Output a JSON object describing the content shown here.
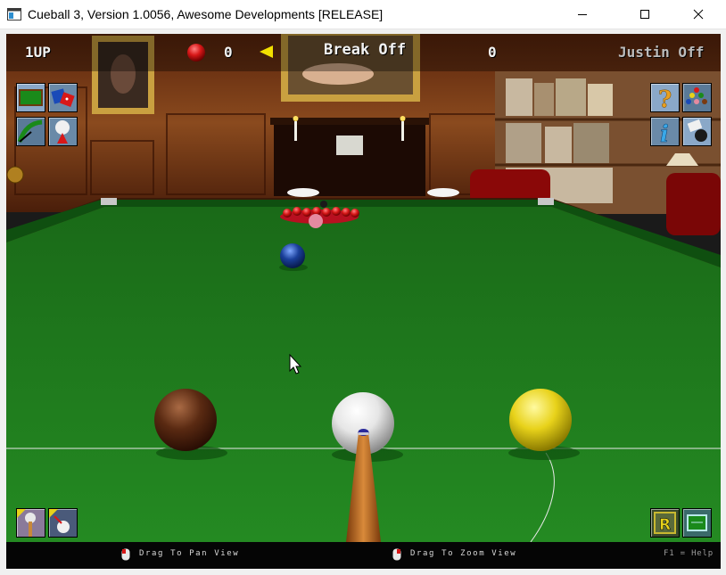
{
  "window": {
    "title": "Cueball 3, Version 1.0056, Awesome Developments [RELEASE]",
    "buttons": [
      "minimize",
      "maximize",
      "close"
    ]
  },
  "hud": {
    "player1_label": "1UP",
    "player1_score": "0",
    "status_message": "Break Off",
    "player2_score": "0",
    "player2_label": "Justin Off",
    "ball_on_color": "#d81818",
    "turn_indicator_color": "#f2e000"
  },
  "toolbar_left_top": [
    {
      "name": "table-view-icon"
    },
    {
      "name": "dice-icon"
    },
    {
      "name": "cue-aim-icon"
    },
    {
      "name": "cue-ball-spin-icon"
    }
  ],
  "toolbar_right_top": [
    {
      "name": "help-icon"
    },
    {
      "name": "ball-rack-icon"
    },
    {
      "name": "info-icon"
    },
    {
      "name": "camera-icon"
    }
  ],
  "toolbar_bottom_left": [
    {
      "name": "cue-height-icon"
    },
    {
      "name": "cue-ball-position-icon"
    }
  ],
  "toolbar_bottom_right": [
    {
      "name": "replay-icon"
    },
    {
      "name": "view-toggle-icon"
    }
  ],
  "status_bar": {
    "pan_hint": "Drag To Pan View",
    "zoom_hint": "Drag To Zoom View",
    "help_hint": "F1 = Help"
  },
  "colors": {
    "cloth": "#1f7a1c",
    "cushion": "#0f4f10",
    "wood": "#6b3416",
    "brown_ball": "#5a2a12",
    "yellow_ball": "#e8d21a",
    "blue_ball": "#1a3f9a",
    "pink_ball": "#e58aa0",
    "red_ball": "#c81420"
  }
}
